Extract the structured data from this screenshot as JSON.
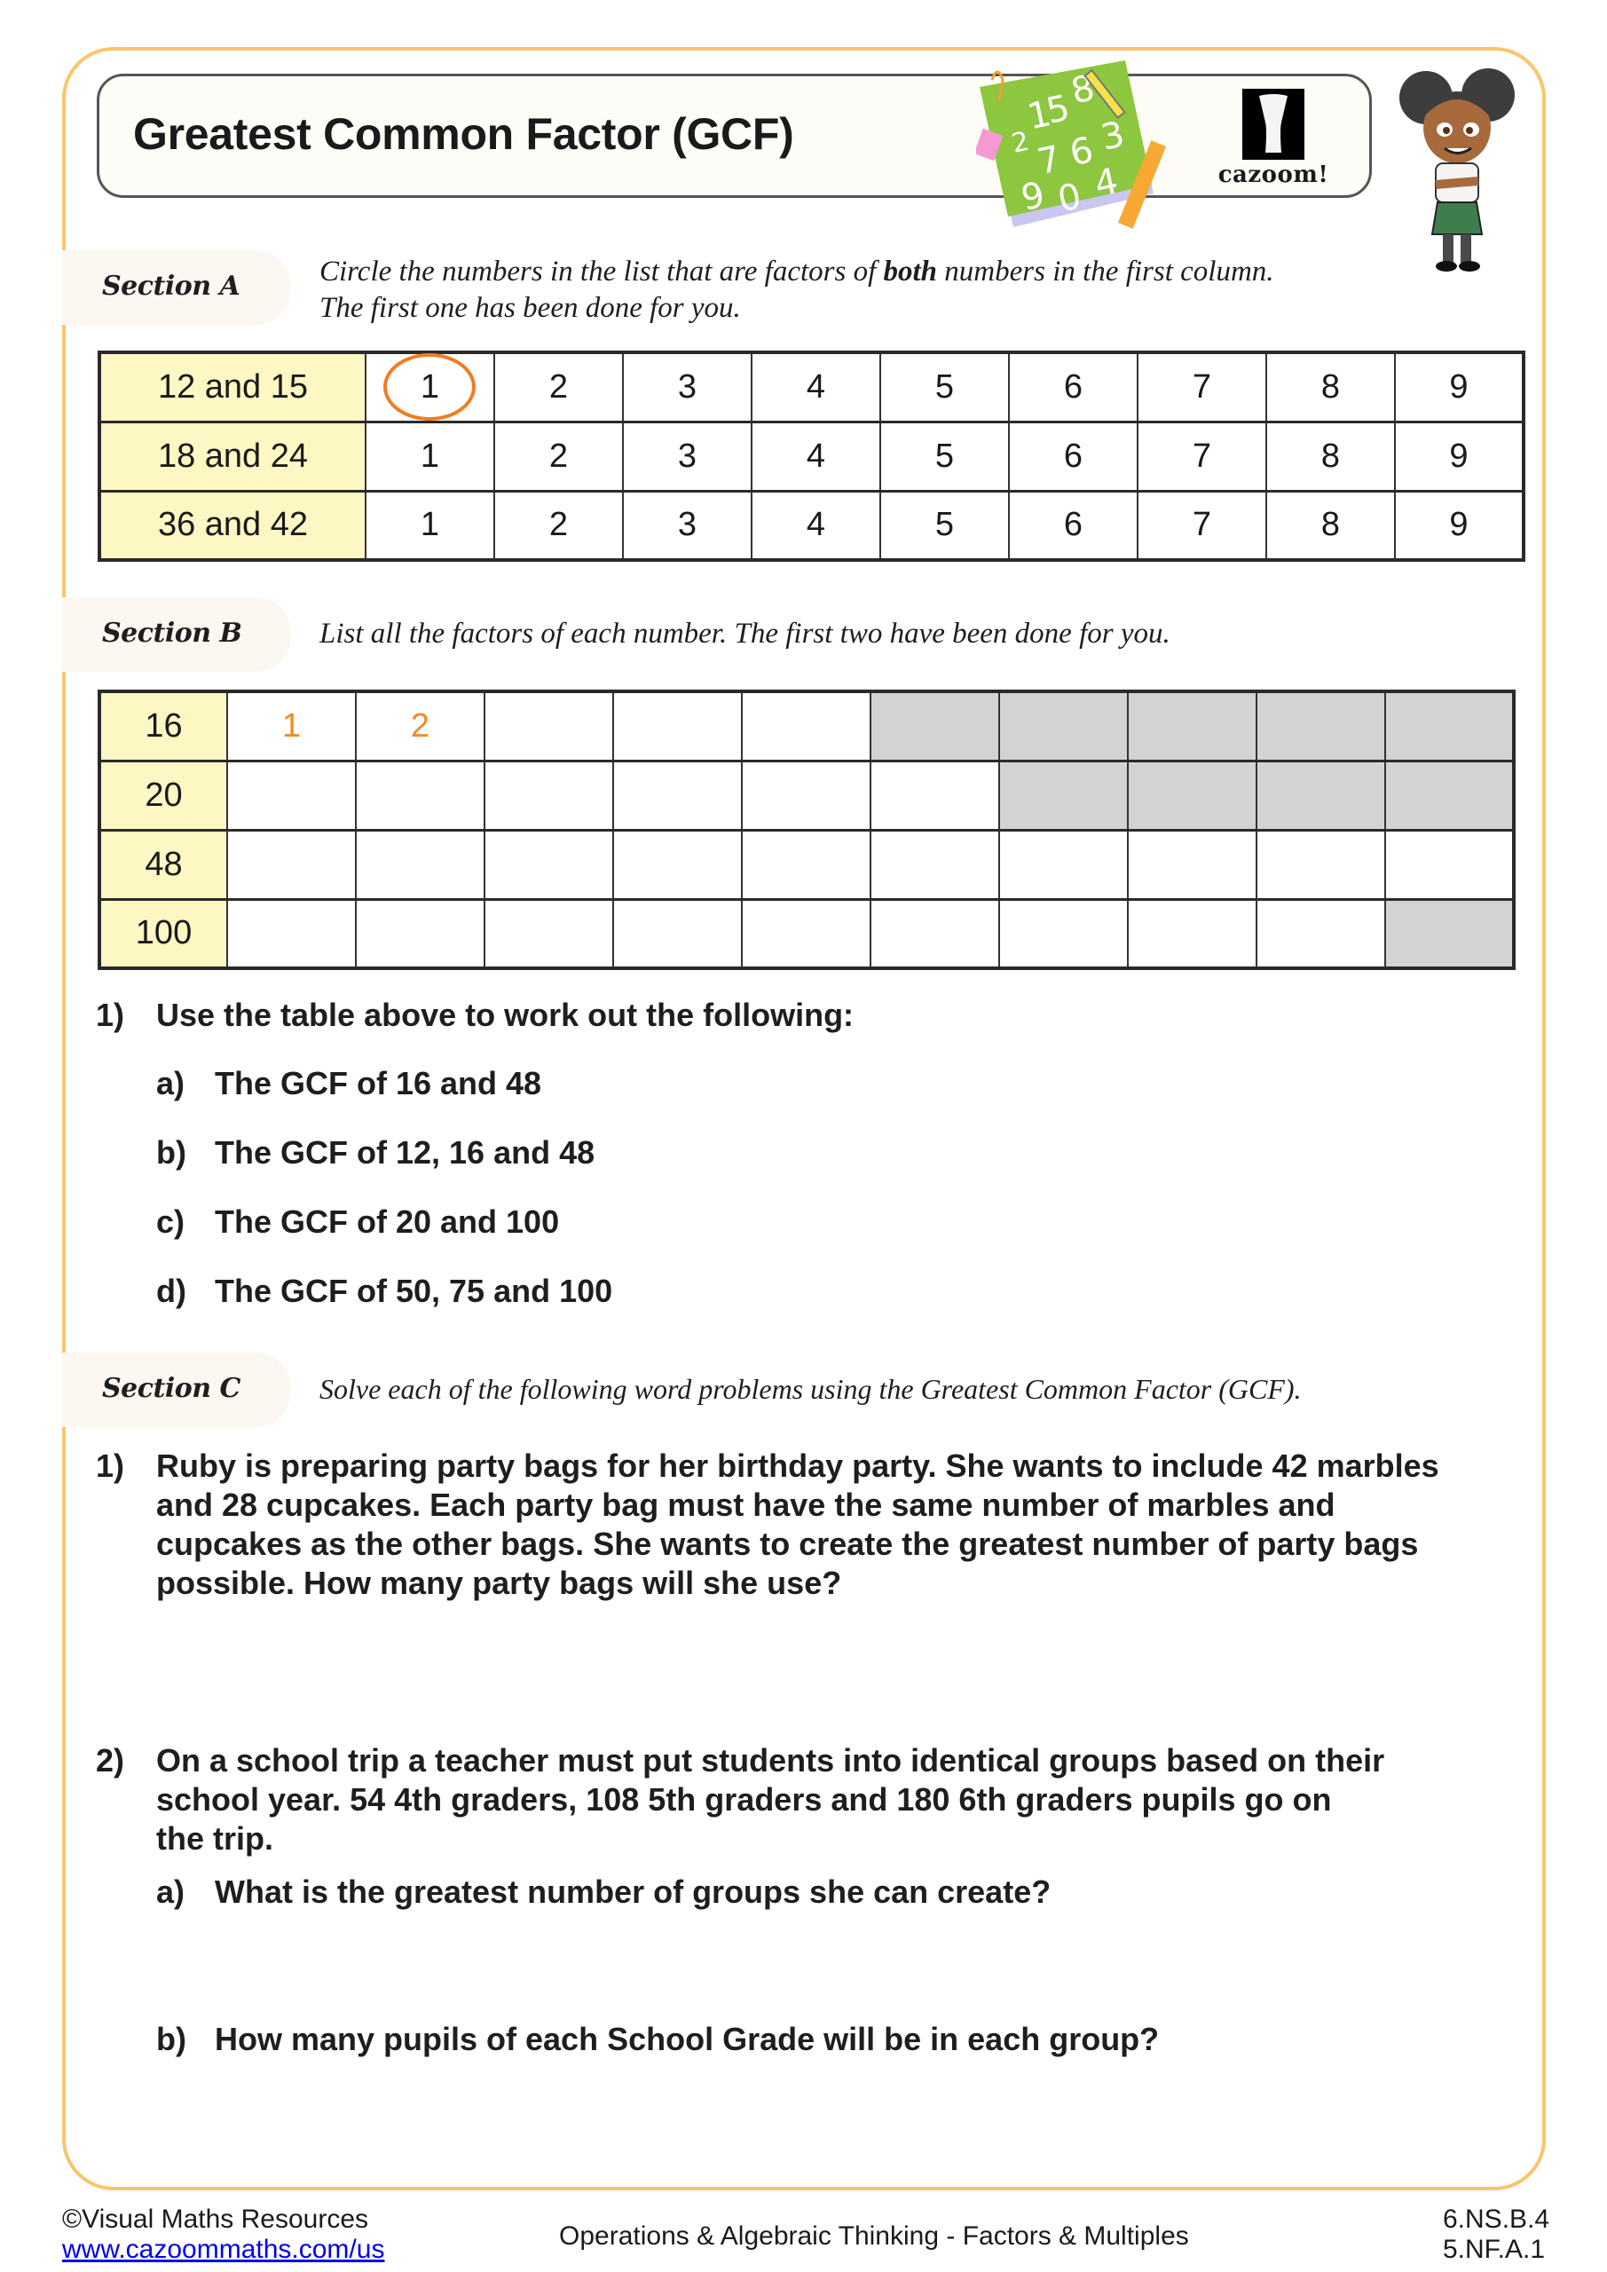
{
  "header": {
    "title": "Greatest Common Factor (GCF)",
    "logo_text": "cazoom!"
  },
  "section_a": {
    "label": "Section A",
    "instruction_pre": "Circle the numbers in the list that are factors of ",
    "instruction_bold": "both",
    "instruction_post": " numbers in the first column.",
    "instruction_line2": "The first one has been done for you.",
    "rows": [
      {
        "label": "12 and 15",
        "options": [
          "1",
          "2",
          "3",
          "4",
          "5",
          "6",
          "7",
          "8",
          "9"
        ],
        "circled": [
          "1"
        ]
      },
      {
        "label": "18 and 24",
        "options": [
          "1",
          "2",
          "3",
          "4",
          "5",
          "6",
          "7",
          "8",
          "9"
        ],
        "circled": []
      },
      {
        "label": "36 and 42",
        "options": [
          "1",
          "2",
          "3",
          "4",
          "5",
          "6",
          "7",
          "8",
          "9"
        ],
        "circled": []
      }
    ]
  },
  "section_b": {
    "label": "Section B",
    "instruction": "List all the factors of each number. The first two have been done for you.",
    "rows": [
      {
        "number": "16",
        "cells": [
          "1",
          "2",
          "",
          "",
          ""
        ],
        "grey_cells": 5
      },
      {
        "number": "20",
        "cells": [
          "",
          "",
          "",
          "",
          "",
          ""
        ],
        "grey_cells": 4
      },
      {
        "number": "48",
        "cells": [
          "",
          "",
          "",
          "",
          "",
          "",
          "",
          "",
          "",
          ""
        ],
        "grey_cells": 0
      },
      {
        "number": "100",
        "cells": [
          "",
          "",
          "",
          "",
          "",
          "",
          "",
          "",
          ""
        ],
        "grey_cells": 1
      }
    ],
    "question": {
      "number": "1)",
      "text": "Use the table above to work out the following:",
      "parts": [
        {
          "label": "a)",
          "text": "The GCF of 16 and 48"
        },
        {
          "label": "b)",
          "text": "The GCF of 12, 16 and 48"
        },
        {
          "label": "c)",
          "text": "The GCF of 20 and 100"
        },
        {
          "label": "d)",
          "text": "The GCF of 50, 75 and 100"
        }
      ]
    }
  },
  "section_c": {
    "label": "Section C",
    "instruction": "Solve each of the following word problems using the Greatest Common Factor (GCF).",
    "questions": [
      {
        "number": "1)",
        "lines": [
          "Ruby is preparing party bags for her birthday party. She wants to include 42 marbles",
          "and 28 cupcakes. Each party bag must have the same number of marbles and",
          "cupcakes as the other bags. She wants to create the greatest number of party bags",
          "possible. How many party bags will she use?"
        ]
      },
      {
        "number": "2)",
        "lines": [
          "On a school trip a teacher must put students into identical groups based on their",
          "school year. 54 4th graders, 108 5th graders and 180 6th graders pupils go on",
          "the trip."
        ],
        "parts": [
          {
            "label": "a)",
            "text": "What is the greatest number of groups she can create?"
          },
          {
            "label": "b)",
            "text": "How many pupils of each School Grade will be in each group?"
          }
        ]
      }
    ]
  },
  "footer": {
    "copyright": "©Visual Maths Resources",
    "link": "www.cazoommaths.com/us",
    "topic": "Operations & Algebraic Thinking - Factors & Multiples",
    "standards": [
      "6.NS.B.4",
      "5.NF.A.1"
    ]
  },
  "colors": {
    "border": "#fcc46b",
    "accent_orange": "#f28a26",
    "header_cell": "#fdf7c3",
    "grey_cell": "#d2d3d5",
    "section_tab": "#fcf7f1"
  }
}
